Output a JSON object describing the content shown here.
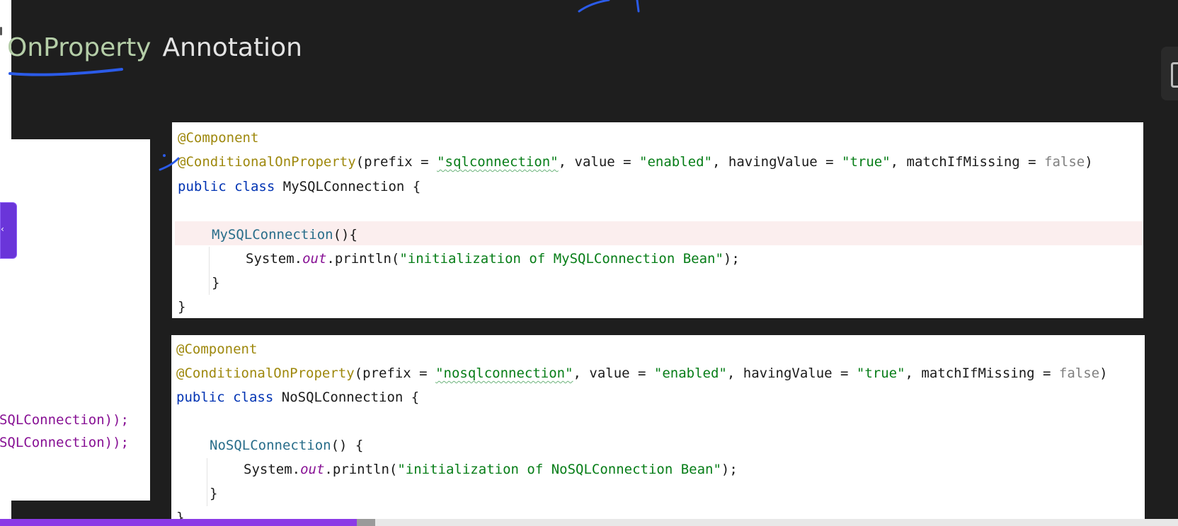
{
  "slide": {
    "title_highlight": "OnProperty",
    "title_rest": "Annotation"
  },
  "left_panel": {
    "lines": [
      "SQLConnection));",
      "SQLConnection));"
    ]
  },
  "code_block_1": {
    "annotation_component": "@Component",
    "annotation_conditional": "@ConditionalOnProperty",
    "prefix_label": "(prefix = ",
    "prefix_value": "\"sqlconnection\"",
    "value_label": ", value = ",
    "value_value": "\"enabled\"",
    "having_label": ", havingValue = ",
    "having_value": "\"true\"",
    "missing_label": ", matchIfMissing = ",
    "missing_value": "false",
    "close_paren": ")",
    "kw_public": "public",
    "kw_class": "class",
    "class_decl": "MySQLConnection {",
    "ctor_name": "MySQLConnection",
    "ctor_tail": "(){",
    "sys": "System.",
    "out": "out",
    "println": ".println(",
    "message": "\"initialization of MySQLConnection Bean\"",
    "println_end": ");",
    "inner_close": "}",
    "outer_close": "}"
  },
  "code_block_2": {
    "annotation_component": "@Component",
    "annotation_conditional": "@ConditionalOnProperty",
    "prefix_label": "(prefix = ",
    "prefix_value": "\"nosqlconnection\"",
    "value_label": ", value = ",
    "value_value": "\"enabled\"",
    "having_label": ", havingValue = ",
    "having_value": "\"true\"",
    "missing_label": ", matchIfMissing = ",
    "missing_value": "false",
    "close_paren": ")",
    "kw_public": "public",
    "kw_class": "class",
    "class_decl": "NoSQLConnection {",
    "ctor_name": "NoSQLConnection",
    "ctor_tail": "() {",
    "sys": "System.",
    "out": "out",
    "println": ".println(",
    "message": "\"initialization of NoSQLConnection Bean\"",
    "println_end": ");",
    "inner_close": "}",
    "outer_close": "}"
  },
  "playback": {
    "progress": 0.303
  },
  "colors": {
    "background": "#1e1e1e",
    "title_accent": "#b5cea8",
    "ink_pen": "#2b5be8",
    "progress": "#8b3ae6",
    "side_tab": "#6a35d9"
  },
  "icons": {
    "side_tab": "chevron-left-icon",
    "right_widget": "panel-toggle-icon"
  }
}
